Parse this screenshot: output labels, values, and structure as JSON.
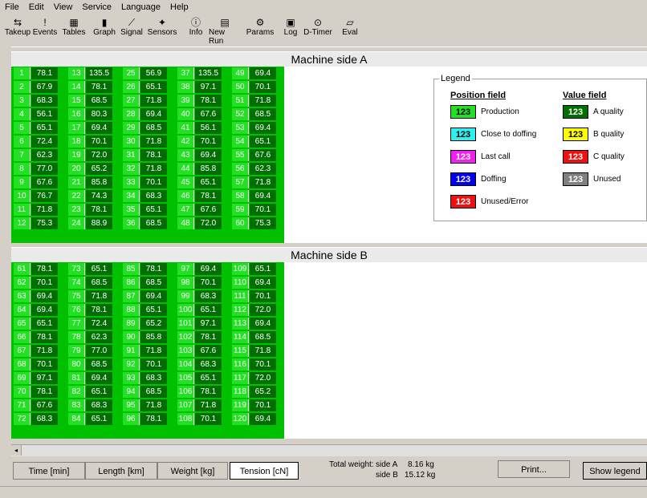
{
  "menu": [
    "File",
    "Edit",
    "View",
    "Service",
    "Language",
    "Help"
  ],
  "toolbar": [
    {
      "label": "Takeup",
      "icon": "takeup-icon",
      "glyph": "⇆"
    },
    {
      "label": "Events",
      "icon": "events-icon",
      "glyph": "!"
    },
    {
      "label": "Tables",
      "icon": "tables-icon",
      "glyph": "▦"
    },
    {
      "label": "Graph",
      "icon": "graph-icon",
      "glyph": "▮"
    },
    {
      "label": "Signal",
      "icon": "signal-icon",
      "glyph": "⟋"
    },
    {
      "label": "Sensors",
      "icon": "sensors-icon",
      "glyph": "✦"
    },
    {
      "label": "Info",
      "icon": "info-icon",
      "glyph": "ⓘ"
    },
    {
      "label": "New Run",
      "icon": "new-run-icon",
      "glyph": "▤"
    },
    {
      "label": "Params",
      "icon": "params-icon",
      "glyph": "⚙"
    },
    {
      "label": "Log",
      "icon": "log-icon",
      "glyph": "▣"
    },
    {
      "label": "D-Timer",
      "icon": "d-timer-icon",
      "glyph": "⊙"
    },
    {
      "label": "Eval",
      "icon": "eval-icon",
      "glyph": "▱"
    }
  ],
  "side_a": {
    "title": "Machine side A",
    "columns": [
      {
        "pos": [
          "1",
          "2",
          "3",
          "4",
          "5",
          "6",
          "7",
          "8",
          "9",
          "10",
          "11",
          "12"
        ],
        "val": [
          "78.1",
          "67.9",
          "68.3",
          "56.1",
          "65.1",
          "72.4",
          "62.3",
          "77.0",
          "67.6",
          "76.7",
          "71.8",
          "75.3"
        ]
      },
      {
        "pos": [
          "13",
          "14",
          "15",
          "16",
          "17",
          "18",
          "19",
          "20",
          "21",
          "22",
          "23",
          "24"
        ],
        "val": [
          "135.5",
          "78.1",
          "68.5",
          "80.3",
          "69.4",
          "70.1",
          "72.0",
          "65.2",
          "85.8",
          "74.3",
          "78.1",
          "88.9"
        ]
      },
      {
        "pos": [
          "25",
          "26",
          "27",
          "28",
          "29",
          "30",
          "31",
          "32",
          "33",
          "34",
          "35",
          "36"
        ],
        "val": [
          "56.9",
          "65.1",
          "71.8",
          "69.4",
          "68.5",
          "71.8",
          "78.1",
          "71.8",
          "70.1",
          "68.3",
          "65.1",
          "68.5"
        ]
      },
      {
        "pos": [
          "37",
          "38",
          "39",
          "40",
          "41",
          "42",
          "43",
          "44",
          "45",
          "46",
          "47",
          "48"
        ],
        "val": [
          "135.5",
          "97.1",
          "78.1",
          "67.6",
          "56.1",
          "70.1",
          "69.4",
          "85.8",
          "65.1",
          "78.1",
          "67.6",
          "72.0"
        ]
      },
      {
        "pos": [
          "49",
          "50",
          "51",
          "52",
          "53",
          "54",
          "55",
          "56",
          "57",
          "58",
          "59",
          "60"
        ],
        "val": [
          "69.4",
          "70.1",
          "71.8",
          "68.5",
          "69.4",
          "65.1",
          "67.6",
          "62.3",
          "71.8",
          "69.4",
          "70.1",
          "75.3"
        ]
      }
    ]
  },
  "side_b": {
    "title": "Machine side B",
    "columns": [
      {
        "pos": [
          "61",
          "62",
          "63",
          "64",
          "65",
          "66",
          "67",
          "68",
          "69",
          "70",
          "71",
          "72"
        ],
        "val": [
          "78.1",
          "70.1",
          "69.4",
          "69.4",
          "65.1",
          "78.1",
          "71.8",
          "70.1",
          "97.1",
          "78.1",
          "67.6",
          "68.3"
        ]
      },
      {
        "pos": [
          "73",
          "74",
          "75",
          "76",
          "77",
          "78",
          "79",
          "80",
          "81",
          "82",
          "83",
          "84"
        ],
        "val": [
          "65.1",
          "68.5",
          "71.8",
          "78.1",
          "72.4",
          "62.3",
          "77.0",
          "68.5",
          "69.4",
          "65.1",
          "68.3",
          "65.1"
        ]
      },
      {
        "pos": [
          "85",
          "86",
          "87",
          "88",
          "89",
          "90",
          "91",
          "92",
          "93",
          "94",
          "95",
          "96"
        ],
        "val": [
          "78.1",
          "68.5",
          "69.4",
          "65.1",
          "65.2",
          "85.8",
          "71.8",
          "70.1",
          "68.3",
          "68.5",
          "71.8",
          "78.1"
        ]
      },
      {
        "pos": [
          "97",
          "98",
          "99",
          "100",
          "101",
          "102",
          "103",
          "104",
          "105",
          "106",
          "107",
          "108"
        ],
        "val": [
          "69.4",
          "70.1",
          "68.3",
          "65.1",
          "97.1",
          "78.1",
          "67.6",
          "68.3",
          "65.1",
          "78.1",
          "71.8",
          "70.1"
        ]
      },
      {
        "pos": [
          "109",
          "110",
          "111",
          "112",
          "113",
          "114",
          "115",
          "116",
          "117",
          "118",
          "119",
          "120"
        ],
        "val": [
          "65.1",
          "69.4",
          "70.1",
          "72.0",
          "69.4",
          "68.5",
          "71.8",
          "70.1",
          "72.0",
          "65.2",
          "70.1",
          "69.4"
        ]
      }
    ]
  },
  "legend": {
    "title": "Legend",
    "position_head": "Position field",
    "value_head": "Value field",
    "swatch_text": "123",
    "position_items": [
      {
        "label": "Production",
        "color": "#22e022",
        "text_color": "#000000"
      },
      {
        "label": "Close to doffing",
        "color": "#33eeee",
        "text_color": "#000000"
      },
      {
        "label": "Last call",
        "color": "#ee22ee",
        "text_color": "#ffffff"
      },
      {
        "label": "Doffing",
        "color": "#0000ee",
        "text_color": "#ffffff"
      },
      {
        "label": "Unused/Error",
        "color": "#ee1111",
        "text_color": "#ffffff"
      }
    ],
    "value_items": [
      {
        "label": "A quality",
        "color": "#006e00",
        "text_color": "#ffffff"
      },
      {
        "label": "B quality",
        "color": "#ffff00",
        "text_color": "#000000"
      },
      {
        "label": "C quality",
        "color": "#ee1111",
        "text_color": "#ffffff"
      },
      {
        "label": "Unused",
        "color": "#808080",
        "text_color": "#ffffff"
      }
    ]
  },
  "bottom": {
    "buttons": [
      "Time [min]",
      "Length [km]",
      "Weight [kg]",
      "Tension [cN]"
    ],
    "total_weight_label": "Total weight:",
    "side_a_label": "side A",
    "side_a_value": "8.16 kg",
    "side_b_label": "side B",
    "side_b_value": "15.12 kg",
    "print": "Print...",
    "show_legend": "Show legend"
  }
}
